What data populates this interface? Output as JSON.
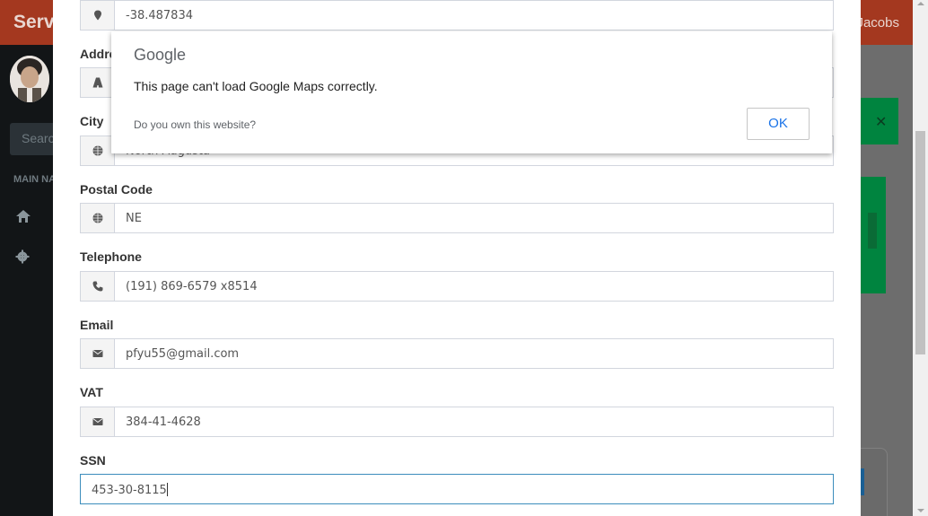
{
  "app": {
    "brand": "Serv",
    "username": "Jacobs",
    "search_placeholder": "Search...",
    "nav_header": "MAIN NAVIGATION"
  },
  "form": {
    "fields": [
      {
        "id": "longitude",
        "label": "",
        "value": "-38.487834",
        "icon": "map-marker-icon"
      },
      {
        "id": "address",
        "label": "Address",
        "value": "",
        "icon": "road-icon"
      },
      {
        "id": "city",
        "label": "City",
        "value": "North Augusta",
        "icon": "globe-icon"
      },
      {
        "id": "postal_code",
        "label": "Postal Code",
        "value": "NE",
        "icon": "globe-icon"
      },
      {
        "id": "telephone",
        "label": "Telephone",
        "value": "(191) 869-6579 x8514",
        "icon": "phone-icon"
      },
      {
        "id": "email",
        "label": "Email",
        "value": "pfyu55@gmail.com",
        "icon": "envelope-icon"
      },
      {
        "id": "vat",
        "label": "VAT",
        "value": "384-41-4628",
        "icon": "envelope-icon"
      },
      {
        "id": "ssn",
        "label": "SSN",
        "value": "453-30-8115",
        "icon": ""
      }
    ]
  },
  "google_popup": {
    "logo": "Google",
    "message": "This page can't load Google Maps correctly.",
    "question": "Do you own this website?",
    "ok_label": "OK"
  }
}
